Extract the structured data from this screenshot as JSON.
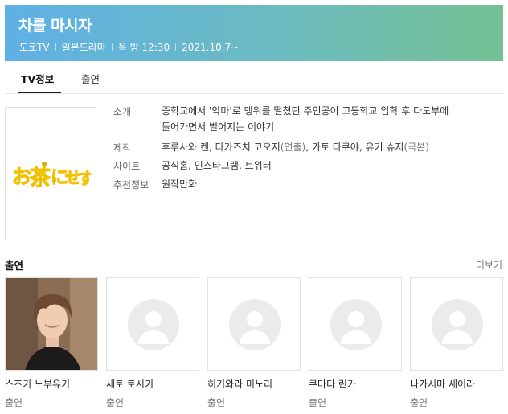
{
  "header": {
    "title": "차를 마시자",
    "meta": [
      "도쿄TV",
      "일본드라마",
      "목 밤 12:30",
      "2021.10.7~"
    ],
    "gradient": [
      "#5fb0e6",
      "#74c093"
    ]
  },
  "tabs": [
    {
      "label": "TV정보",
      "active": true
    },
    {
      "label": "출연",
      "active": false
    }
  ],
  "poster": {
    "logo_text": "お茶にせす"
  },
  "info": {
    "intro_label": "소개",
    "intro_text_line1": "중학교에서 '악마'로 맹위를 떨쳤던 주인공이 고등학교 입학 후 다도부에",
    "intro_text_line2": "들어가면서 벌어지는 이야기",
    "production_label": "제작",
    "production_1": "후루사와 켄, 타카즈치 코오지",
    "production_1_role": "(연출)",
    "production_2": ", 카토 타쿠야, 유키 슈지",
    "production_2_role": "(극본)",
    "site_label": "사이트",
    "site_links": [
      "공식홈",
      "인스타그램",
      "트위터"
    ],
    "site_sep": ", ",
    "rec_label": "추천정보",
    "rec_value": "원작만화"
  },
  "cast_section": {
    "title": "출연",
    "more_label": "더보기",
    "members": [
      {
        "name": "스즈키 노부유키",
        "role": "출연",
        "has_photo": true
      },
      {
        "name": "세토 토시키",
        "role": "출연",
        "has_photo": false
      },
      {
        "name": "히기와라 미노리",
        "role": "출연",
        "has_photo": false
      },
      {
        "name": "쿠마다 린카",
        "role": "출연",
        "has_photo": false
      },
      {
        "name": "나가시마 세이라",
        "role": "출연",
        "has_photo": false
      }
    ]
  }
}
